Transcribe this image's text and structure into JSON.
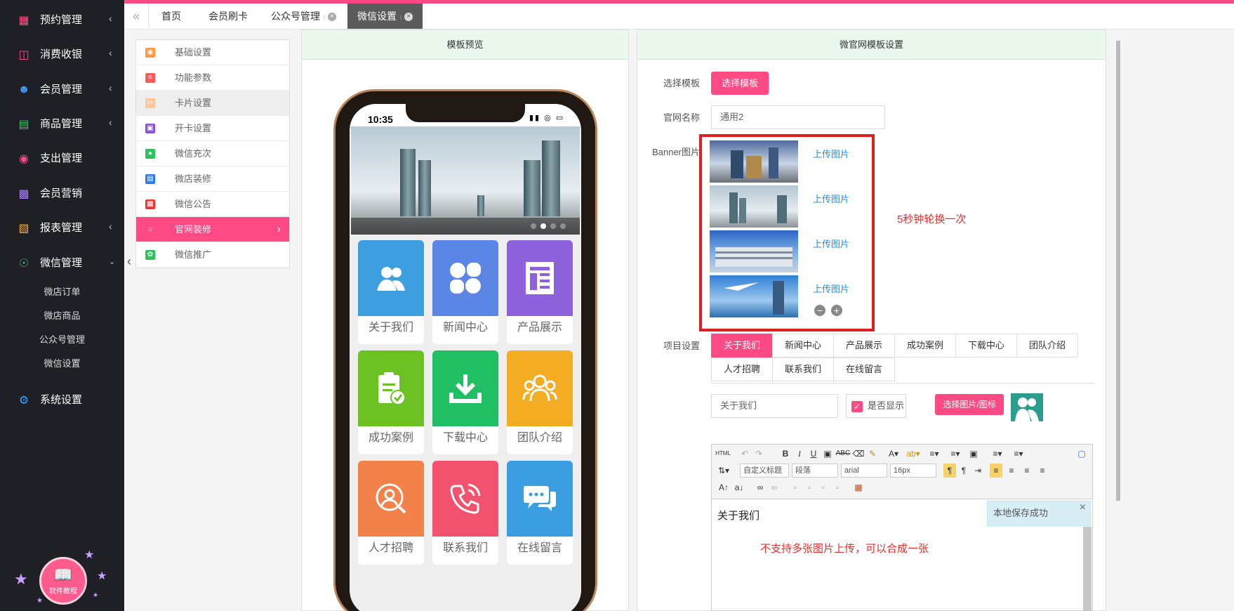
{
  "sidebar": {
    "items": [
      {
        "label": "预约管理",
        "icon": "calendar-icon"
      },
      {
        "label": "消费收银",
        "icon": "cashier-icon"
      },
      {
        "label": "会员管理",
        "icon": "member-icon"
      },
      {
        "label": "商品管理",
        "icon": "goods-icon"
      },
      {
        "label": "支出管理",
        "icon": "expense-icon"
      },
      {
        "label": "会员营销",
        "icon": "gift-icon"
      },
      {
        "label": "报表管理",
        "icon": "report-icon"
      },
      {
        "label": "微信管理",
        "icon": "wechat-icon"
      },
      {
        "label": "系统设置",
        "icon": "gear-icon"
      }
    ],
    "sub_items": [
      "微店订单",
      "微店商品",
      "公众号管理",
      "微信设置"
    ],
    "tutorial_label": "软件教程"
  },
  "tabs": [
    {
      "label": "首页"
    },
    {
      "label": "会员刷卡"
    },
    {
      "label": "公众号管理"
    },
    {
      "label": "微信设置"
    }
  ],
  "settings_menu": [
    "基础设置",
    "功能参数",
    "卡片设置",
    "开卡设置",
    "微信充次",
    "微店装修",
    "微信公告",
    "官网装修",
    "微信推广"
  ],
  "preview": {
    "header": "模板预览",
    "time": "10:35",
    "tiles": [
      "关于我们",
      "新闻中心",
      "产品展示",
      "成功案例",
      "下载中心",
      "团队介绍",
      "人才招聘",
      "联系我们",
      "在线留言"
    ]
  },
  "form": {
    "header": "微官网模板设置",
    "template_label": "选择模板",
    "template_button": "选择模板",
    "site_name_label": "官网名称",
    "site_name_value": "通用2",
    "banner_label": "Banner图片",
    "upload_label": "上传图片",
    "banner_note": "5秒钟轮换一次",
    "project_label": "项目设置",
    "project_tabs": [
      "关于我们",
      "新闻中心",
      "产品展示",
      "成功案例",
      "下载中心",
      "团队介绍",
      "人才招聘",
      "联系我们",
      "在线留言"
    ],
    "item_name_value": "关于我们",
    "show_label": "是否显示",
    "choose_icon_button": "选择图片/图标"
  },
  "editor": {
    "html_btn": "HTML",
    "title_select": "自定义标题",
    "para_select": "段落",
    "font_select": "arial",
    "size_select": "16px",
    "content": "关于我们",
    "note": "不支持多张图片上传，可以合成一张",
    "toast": "本地保存成功"
  }
}
